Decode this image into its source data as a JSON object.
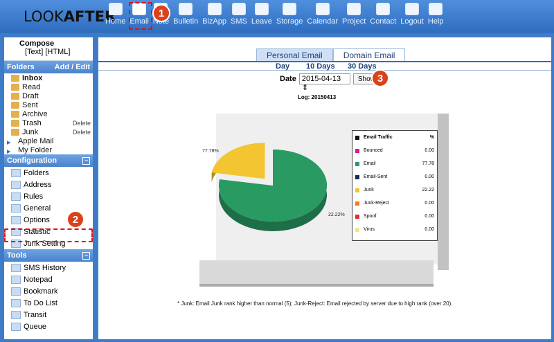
{
  "app": {
    "logo_prefix": "LOOK",
    "logo_bold": "AFTER"
  },
  "nav": [
    {
      "label": "Home",
      "icon": "home-icon"
    },
    {
      "label": "Email",
      "icon": "email-icon"
    },
    {
      "label": "Note",
      "icon": "note-icon"
    },
    {
      "label": "Bulletin",
      "icon": "bulletin-icon"
    },
    {
      "label": "BizApp",
      "icon": "bizapp-icon"
    },
    {
      "label": "SMS",
      "icon": "sms-icon"
    },
    {
      "label": "Leave",
      "icon": "leave-icon"
    },
    {
      "label": "Storage",
      "icon": "storage-icon"
    },
    {
      "label": "Calendar",
      "icon": "calendar-icon"
    },
    {
      "label": "Project",
      "icon": "project-icon"
    },
    {
      "label": "Contact",
      "icon": "contact-icon"
    },
    {
      "label": "Logout",
      "icon": "logout-icon"
    },
    {
      "label": "Help",
      "icon": "help-icon"
    }
  ],
  "callouts": [
    "1",
    "2",
    "3"
  ],
  "sidebar": {
    "compose": {
      "title": "Compose",
      "sub": "[Text] [HTML]"
    },
    "folders_header": "Folders",
    "folders_action": "Add / Edit",
    "folders": [
      {
        "label": "Inbox",
        "action": ""
      },
      {
        "label": "Read",
        "action": ""
      },
      {
        "label": "Draft",
        "action": ""
      },
      {
        "label": "Sent",
        "action": ""
      },
      {
        "label": "Archive",
        "action": ""
      },
      {
        "label": "Trash",
        "action": "Delete"
      },
      {
        "label": "Junk",
        "action": "Delete"
      },
      {
        "label": "Apple Mail",
        "action": ""
      },
      {
        "label": "My Folder",
        "action": ""
      }
    ],
    "config_header": "Configuration",
    "config": [
      "Folders",
      "Address",
      "Rules",
      "General",
      "Options",
      "Statistic",
      "Junk Setting"
    ],
    "tools_header": "Tools",
    "tools": [
      "SMS History",
      "Notepad",
      "Bookmark",
      "To Do List",
      "Transit",
      "Queue"
    ]
  },
  "main": {
    "tabs": [
      "Personal Email",
      "Domain Email"
    ],
    "subtabs": [
      "Day",
      "10 Days",
      "30 Days"
    ],
    "date_label": "Date",
    "date_value": "2015-04-13",
    "show_label": "Show",
    "log_label": "Log: 20150413",
    "footnote": "* Junk: Email Junk rank higher than normal (5); Junk-Reject: Email rejected by server due to high rank (over 20)."
  },
  "chart_data": {
    "type": "pie",
    "legend_title": "Email Traffic",
    "legend_unit": "%",
    "labels": [
      "Bounced",
      "Email",
      "Email-Sent",
      "Junk",
      "Junk-Reject",
      "Spoof",
      "Virus"
    ],
    "values": [
      0.0,
      77.78,
      0.0,
      22.22,
      0.0,
      0.0,
      0.0
    ],
    "value_labels": [
      "0.00",
      "77.78",
      "0.00",
      "22.22",
      "0.00",
      "0.00",
      "0.00"
    ],
    "colors": [
      "#d61f8f",
      "#2a9a63",
      "#1a2a4a",
      "#f3c531",
      "#f27b1d",
      "#e12d2d",
      "#f6e47e"
    ],
    "slice_labels": [
      "77.78%",
      "22.22%"
    ]
  }
}
